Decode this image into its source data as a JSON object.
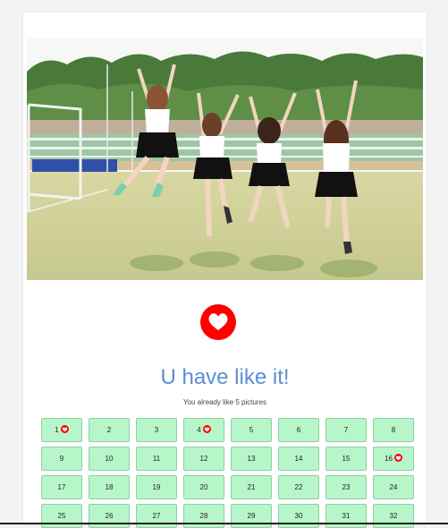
{
  "like": {
    "title": "U have like it!",
    "message": "You already like 5 pictures"
  },
  "icons": {
    "like": "heart-icon"
  },
  "colors": {
    "like": "#ff0000",
    "title": "#5b8fd4",
    "cell": "#b7f6c9"
  },
  "photo": {
    "subject": "four girls jumping on a sports field"
  },
  "pictures": [
    {
      "label": "1",
      "liked": true
    },
    {
      "label": "2",
      "liked": false
    },
    {
      "label": "3",
      "liked": false
    },
    {
      "label": "4",
      "liked": true
    },
    {
      "label": "5",
      "liked": false
    },
    {
      "label": "6",
      "liked": false
    },
    {
      "label": "7",
      "liked": false
    },
    {
      "label": "8",
      "liked": false
    },
    {
      "label": "9",
      "liked": false
    },
    {
      "label": "10",
      "liked": false
    },
    {
      "label": "11",
      "liked": false
    },
    {
      "label": "12",
      "liked": false
    },
    {
      "label": "13",
      "liked": false
    },
    {
      "label": "14",
      "liked": false
    },
    {
      "label": "15",
      "liked": false
    },
    {
      "label": "16",
      "liked": true
    },
    {
      "label": "17",
      "liked": false
    },
    {
      "label": "18",
      "liked": false
    },
    {
      "label": "19",
      "liked": false
    },
    {
      "label": "20",
      "liked": false
    },
    {
      "label": "21",
      "liked": false
    },
    {
      "label": "22",
      "liked": false
    },
    {
      "label": "23",
      "liked": false
    },
    {
      "label": "24",
      "liked": false
    },
    {
      "label": "25",
      "liked": false
    },
    {
      "label": "26",
      "liked": false
    },
    {
      "label": "27",
      "liked": false
    },
    {
      "label": "28",
      "liked": false
    },
    {
      "label": "29",
      "liked": false
    },
    {
      "label": "30",
      "liked": false
    },
    {
      "label": "31",
      "liked": false
    },
    {
      "label": "32",
      "liked": false
    }
  ]
}
